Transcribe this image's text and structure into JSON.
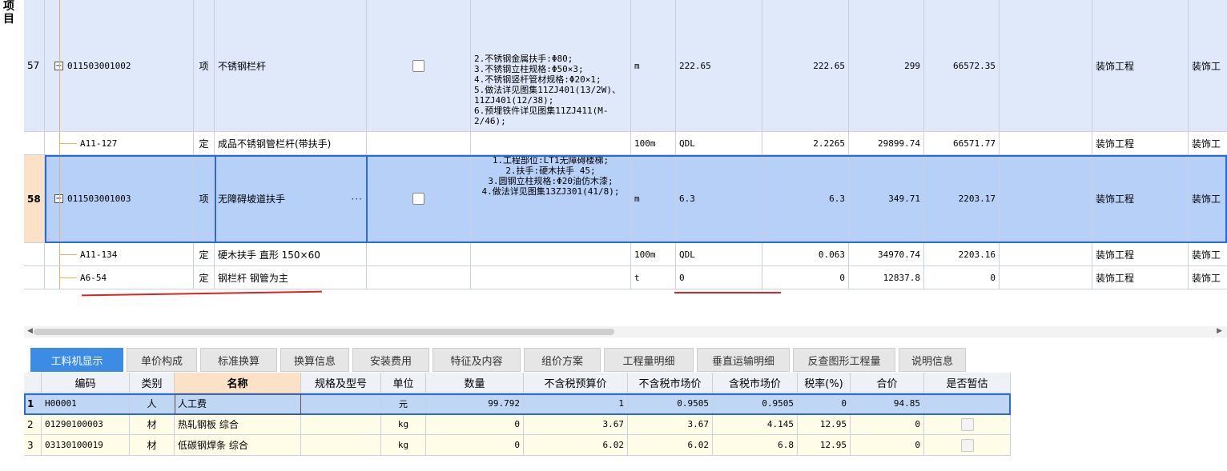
{
  "left_label": "项目",
  "top_rows": [
    {
      "type": "xiang",
      "rownum": "57",
      "code": "011503001002",
      "category": "项",
      "name": "不锈钢栏杆",
      "feature": "2.不锈钢金属扶手:Φ80;\n3.不锈钢立柱规格:Φ50×3;\n4.不锈钢竖杆管材规格:Φ20×1;\n5.做法详见图集11ZJ401(13/2W)、11ZJ401(12/38);\n6.预埋铁件详见图集11ZJ411(M-2/46);",
      "unit": "m",
      "expr": "222.65",
      "qty": "222.65",
      "price": "299",
      "total": "66572.35",
      "major": "装饰工程",
      "major2": "装饰工"
    },
    {
      "type": "ding",
      "rownum": "",
      "code": "A11-127",
      "category": "定",
      "name": "成品不锈钢管栏杆(带扶手)",
      "feature": "",
      "unit": "100m",
      "expr": "QDL",
      "qty": "2.2265",
      "price": "29899.74",
      "total": "66571.77",
      "major": "装饰工程",
      "major2": "装饰工"
    },
    {
      "type": "xiang",
      "rownum": "58",
      "code": "011503001003",
      "category": "项",
      "name": "无障碍坡道扶手",
      "feature": "1.工程部位:LT1无障碍楼梯;\n2.扶手:硬木扶手 45;\n3.圆钢立柱规格:Φ20油仿木漆;\n4.做法详见图集13ZJ301(41/8);",
      "unit": "m",
      "expr": "6.3",
      "qty": "6.3",
      "price": "349.71",
      "total": "2203.17",
      "major": "装饰工程",
      "major2": "装饰工"
    },
    {
      "type": "ding",
      "rownum": "",
      "code": "A11-134",
      "category": "定",
      "name": "硬木扶手 直形 150×60",
      "feature": "",
      "unit": "100m",
      "expr": "QDL",
      "qty": "0.063",
      "price": "34970.74",
      "total": "2203.16",
      "major": "装饰工程",
      "major2": "装饰工"
    },
    {
      "type": "ding",
      "rownum": "",
      "code": "A6-54",
      "category": "定",
      "name": "钢栏杆 钢管为主",
      "feature": "",
      "unit": "t",
      "expr": "0",
      "qty": "0",
      "price": "12837.8",
      "total": "0",
      "major": "装饰工程",
      "major2": "装饰工"
    }
  ],
  "ellipsis": "···",
  "tabs": [
    "工料机显示",
    "单价构成",
    "标准换算",
    "换算信息",
    "安装费用",
    "特征及内容",
    "组价方案",
    "工程量明细",
    "垂直运输明细",
    "反查图形工程量",
    "说明信息"
  ],
  "active_tab": 0,
  "bottom_headers": [
    "",
    "编码",
    "类别",
    "名称",
    "规格及型号",
    "单位",
    "数量",
    "不含税预算价",
    "不含税市场价",
    "含税市场价",
    "税率(%)",
    "合价",
    "是否暂估"
  ],
  "bottom_rows": [
    {
      "rn": "1",
      "code": "H00001",
      "cat": "人",
      "name": "人工费",
      "spec": "",
      "unit": "元",
      "qty": "99.792",
      "budget": "1",
      "market": "0.9505",
      "market_tax": "0.9505",
      "rate": "0",
      "total": "94.85",
      "est": ""
    },
    {
      "rn": "2",
      "code": "01290100003",
      "cat": "材",
      "name": "热轧钢板 综合",
      "spec": "",
      "unit": "kg",
      "qty": "0",
      "budget": "3.67",
      "market": "3.67",
      "market_tax": "4.145",
      "rate": "12.95",
      "total": "0",
      "est": "checkbox"
    },
    {
      "rn": "3",
      "code": "03130100019",
      "cat": "材",
      "name": "低碳钢焊条 综合",
      "spec": "",
      "unit": "kg",
      "qty": "0",
      "budget": "6.02",
      "market": "6.02",
      "market_tax": "6.8",
      "rate": "12.95",
      "total": "0",
      "est": "checkbox"
    }
  ],
  "colors": {
    "accent": "#3c8ce6",
    "selection": "#2a6bd6",
    "annotation": "#e02020"
  }
}
